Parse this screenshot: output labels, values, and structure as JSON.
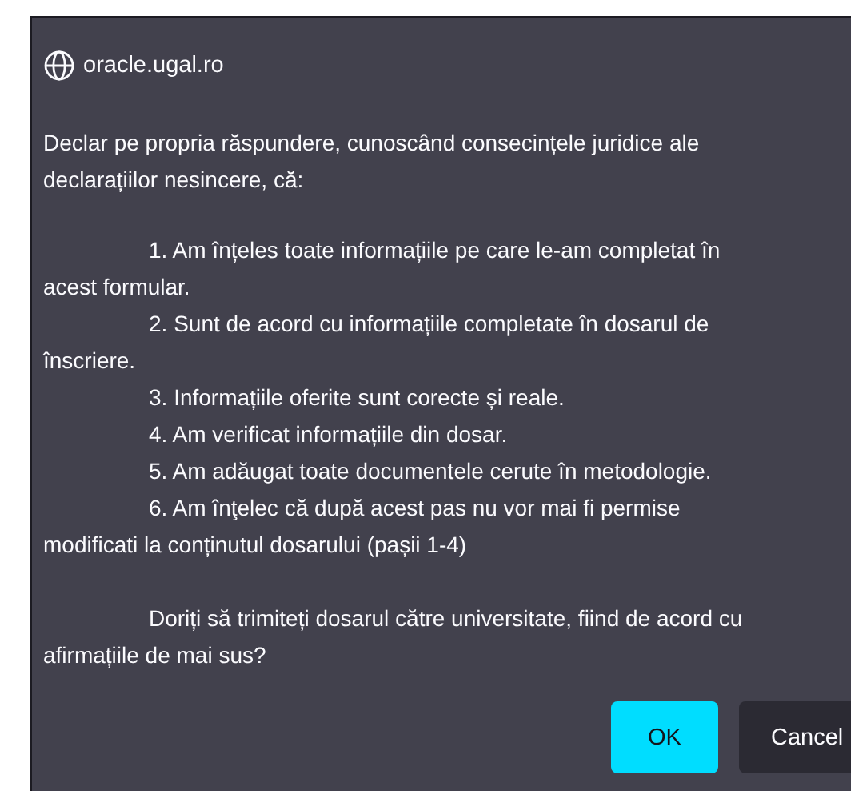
{
  "dialog": {
    "title": "oracle.ugal.ro",
    "intro": {
      "lines": [
        "Declar pe propria răspundere, cunoscând consecințele juridice ale",
        "declarațiilor nesincere, că:"
      ]
    },
    "items": [
      {
        "lines": [
          "1. Am înțeles toate informațiile pe care le-am completat în",
          "acest formular."
        ]
      },
      {
        "lines": [
          "2. Sunt de acord cu informațiile completate în dosarul de",
          "înscriere."
        ]
      },
      {
        "lines": [
          "3. Informațiile oferite sunt corecte și reale."
        ]
      },
      {
        "lines": [
          "4. Am verificat informațiile din dosar."
        ]
      },
      {
        "lines": [
          "5. Am adăugat toate documentele cerute în metodologie."
        ]
      },
      {
        "lines": [
          "6. Am înţelec că după acest pas nu vor mai fi permise",
          "modificati la conținutul dosarului (pașii 1-4)"
        ]
      }
    ],
    "question": {
      "lines": [
        "Doriți să trimiteți dosarul către universitate, fiind de acord cu",
        "afirmațiile de mai sus?"
      ]
    },
    "buttons": [
      {
        "label": "OK",
        "kind": "primary"
      },
      {
        "label": "Cancel",
        "kind": "secondary"
      }
    ]
  }
}
